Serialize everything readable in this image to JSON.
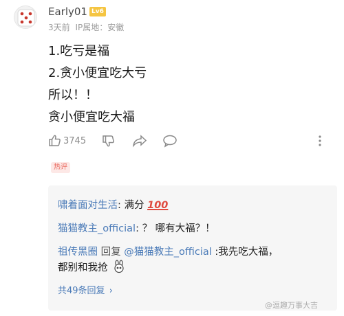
{
  "user": {
    "name": "Early01",
    "level": "Lv6",
    "time": "3天前",
    "ip_location": "IP属地：安徽"
  },
  "post": {
    "lines": [
      "1.吃亏是福",
      "2.贪小便宜吃大亏",
      "所以！！",
      "贪小便宜吃大福"
    ]
  },
  "actions": {
    "like_count": "3745",
    "icons": [
      "thumb-up-icon",
      "thumb-down-icon",
      "share-icon",
      "comment-icon",
      "more-icon"
    ]
  },
  "hot_badge": "热评",
  "replies": [
    {
      "name": "啸着面对生活",
      "text": "满分",
      "emoji": "100"
    },
    {
      "name": "猫猫教主_official",
      "text": "？ 哪有大福？！"
    },
    {
      "name": "祖传黑圈",
      "verb": "回复",
      "mention": "@猫猫教主_official",
      "text": "我先吃大福，",
      "text_cont": "都别和我抢"
    }
  ],
  "see_all": "共49条回复",
  "watermark": "@逗趣万事大吉"
}
